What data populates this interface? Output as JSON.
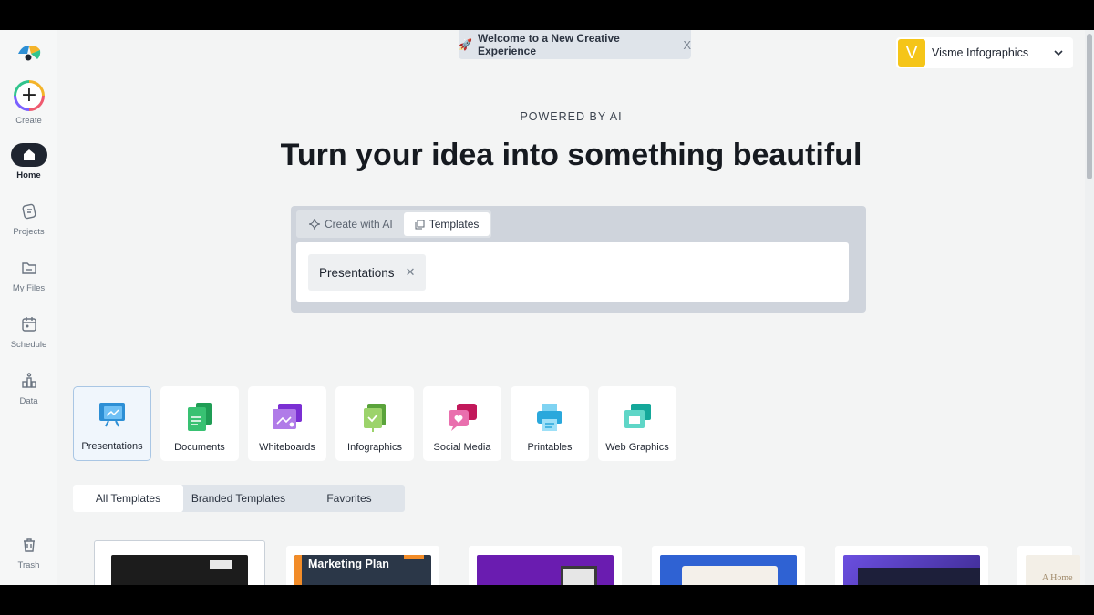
{
  "banner": {
    "text": "Welcome to a New Creative Experience",
    "emoji": "🚀",
    "close": "X"
  },
  "account": {
    "initial": "V",
    "name": "Visme Infographics"
  },
  "sidebar": {
    "create_label": "Create",
    "items": [
      {
        "label": "Home",
        "icon": "home-icon"
      },
      {
        "label": "Projects",
        "icon": "projects-icon"
      },
      {
        "label": "My Files",
        "icon": "folder-icon"
      },
      {
        "label": "Schedule",
        "icon": "calendar-icon"
      },
      {
        "label": "Data",
        "icon": "data-icon"
      }
    ],
    "trash_label": "Trash"
  },
  "hero": {
    "eyebrow": "POWERED BY AI",
    "headline": "Turn your idea into something beautiful"
  },
  "search": {
    "tabs": [
      {
        "label": "Create with AI",
        "icon": "sparkle-icon"
      },
      {
        "label": "Templates",
        "icon": "templates-icon"
      }
    ],
    "chip": "Presentations"
  },
  "categories": [
    {
      "label": "Presentations",
      "icon": "presentations-icon"
    },
    {
      "label": "Documents",
      "icon": "documents-icon"
    },
    {
      "label": "Whiteboards",
      "icon": "whiteboards-icon"
    },
    {
      "label": "Infographics",
      "icon": "infographics-icon"
    },
    {
      "label": "Social Media",
      "icon": "social-media-icon"
    },
    {
      "label": "Printables",
      "icon": "printables-icon"
    },
    {
      "label": "Web Graphics",
      "icon": "web-graphics-icon"
    }
  ],
  "filters": [
    "All Templates",
    "Branded Templates",
    "Favorites"
  ],
  "templates": [
    {
      "title": ""
    },
    {
      "title": "Marketing Plan"
    },
    {
      "title": ""
    },
    {
      "title": ""
    },
    {
      "title": ""
    },
    {
      "title": "A Home"
    }
  ],
  "colors": {
    "accent": "#1f2530",
    "brand_yellow": "#f5c518",
    "active_border": "#a9c6e4"
  }
}
